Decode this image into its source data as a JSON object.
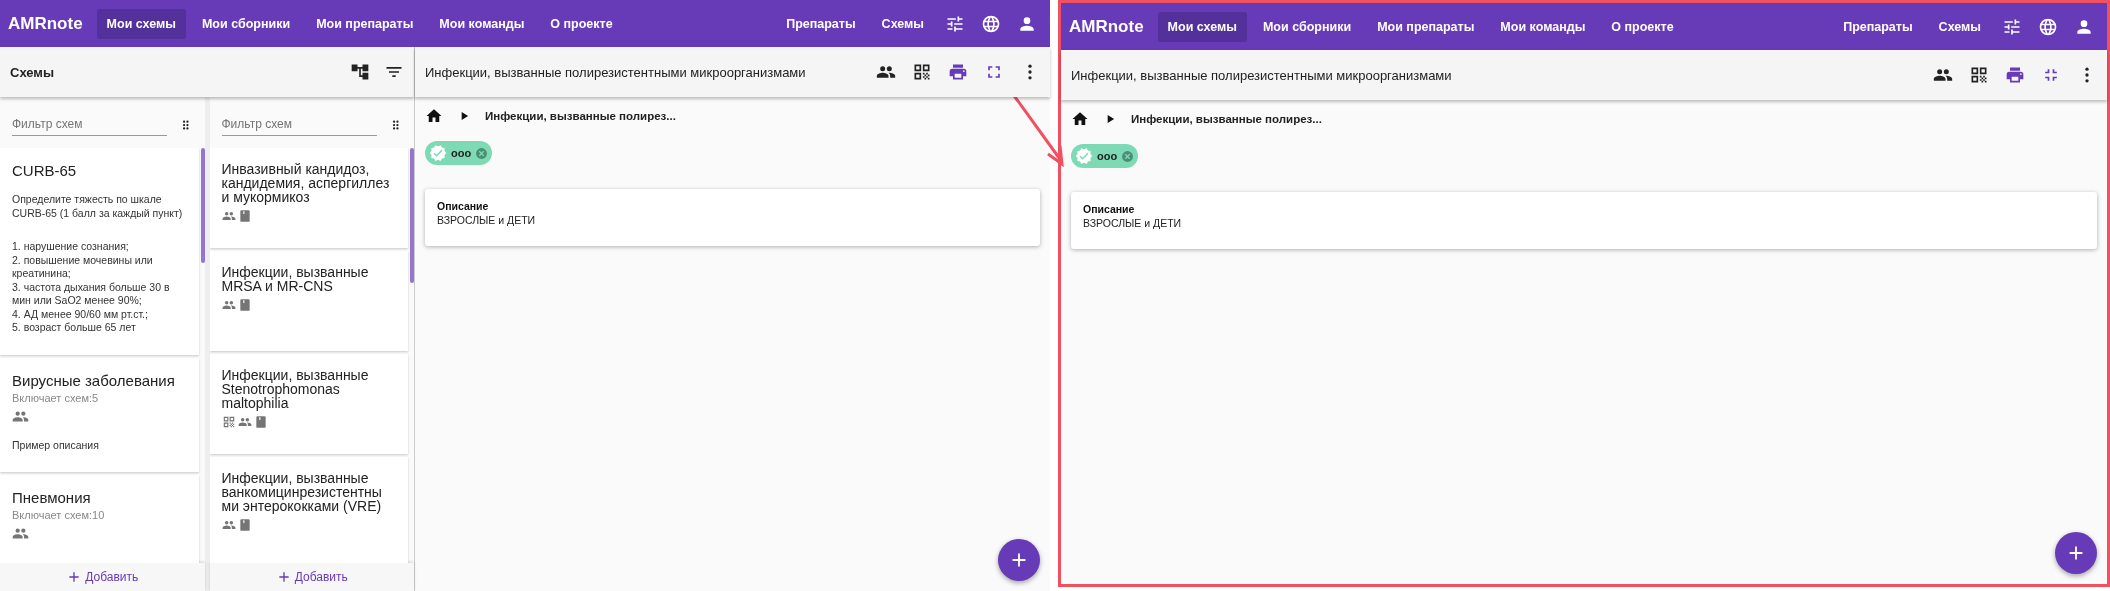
{
  "screens": [
    {
      "navbar": {
        "brand": "AMRnote",
        "links": [
          {
            "label": "Мои схемы",
            "selected": true
          },
          {
            "label": "Мои сборники",
            "selected": false
          },
          {
            "label": "Мои препараты",
            "selected": false
          },
          {
            "label": "Мои команды",
            "selected": false
          },
          {
            "label": "О проекте",
            "selected": false
          }
        ],
        "right_links": [
          "Препараты",
          "Схемы"
        ]
      },
      "sidebar": {
        "title": "Схемы",
        "columns": [
          {
            "filter_placeholder": "Фильтр схем",
            "add_label": "Добавить",
            "cards": [
              {
                "title": "CURB-65",
                "group": false,
                "paragraphs": [
                  "Определите тяжесть по шкале CURB-65 (1 балл за каждый пункт)",
                  "1. нарушение сознания;\n2. повышение мочевины или креатинина;\n3. частота дыхания больше 30 в мин или SaO2 менее 90%;\n4. АД менее 90/60 мм рт.ст.;\n5. возраст больше 65 лет"
                ]
              },
              {
                "title": "Вирусные заболевания",
                "subtitle": "Включает схем:5",
                "group": true,
                "paragraphs": [
                  "Пример описания"
                ]
              },
              {
                "title": "Пневмония",
                "subtitle": "Включает схем:10",
                "group": true
              }
            ]
          },
          {
            "filter_placeholder": "Фильтр схем",
            "add_label": "Добавить",
            "cards": [
              {
                "title": "Инвазивный кандидоз, кандидемия, аспергиллез и мукормикоз",
                "qr": false
              },
              {
                "title": "Инфекции, вызванные MRSA и MR-CNS",
                "qr": false
              },
              {
                "title": "Инфекции, вызванные Stenotrophomonas maltophilia",
                "qr": true
              },
              {
                "title": "Инфекции, вызванные ванкомицинрезистентны ми энтерококками (VRE)",
                "qr": false
              }
            ]
          }
        ]
      },
      "detail": {
        "title": "Инфекции, вызванные полирезистентными микроорганизмами",
        "fullscreen": false,
        "breadcrumb": "Инфекции, вызванные полирез...",
        "tag": "ооо",
        "card": {
          "heading": "Описание",
          "text": "ВЗРОСЛЫЕ и ДЕТИ"
        }
      }
    },
    {
      "navbar": {
        "brand": "AMRnote",
        "links": [
          {
            "label": "Мои схемы",
            "selected": true
          },
          {
            "label": "Мои сборники",
            "selected": false
          },
          {
            "label": "Мои препараты",
            "selected": false
          },
          {
            "label": "Мои команды",
            "selected": false
          },
          {
            "label": "О проекте",
            "selected": false
          }
        ],
        "right_links": [
          "Препараты",
          "Схемы"
        ]
      },
      "detail": {
        "title": "Инфекции, вызванные полирезистентными микроорганизмами",
        "fullscreen": true,
        "breadcrumb": "Инфекции, вызванные полирез...",
        "tag": "ооо",
        "card": {
          "heading": "Описание",
          "text": "ВЗРОСЛЫЕ и ДЕТИ"
        }
      }
    }
  ]
}
